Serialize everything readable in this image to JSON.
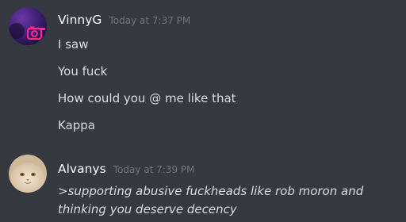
{
  "messages": [
    {
      "author": "VinnyG",
      "timestamp": "Today at 7:37 PM",
      "avatar_icon": "camera-avatar-icon",
      "lines": [
        "I saw",
        "You fuck",
        "How could you @ me like that",
        "Kappa"
      ]
    },
    {
      "author": "Alvanys",
      "timestamp": "Today at 7:39 PM",
      "avatar_icon": "cat-avatar-icon",
      "lines": [
        ">supporting abusive fuckheads like rob moron and",
        "thinking you deserve decency"
      ]
    }
  ],
  "colors": {
    "background": "#36393f",
    "author": "#ffffff",
    "timestamp": "#72767d",
    "text": "#dcddde"
  }
}
